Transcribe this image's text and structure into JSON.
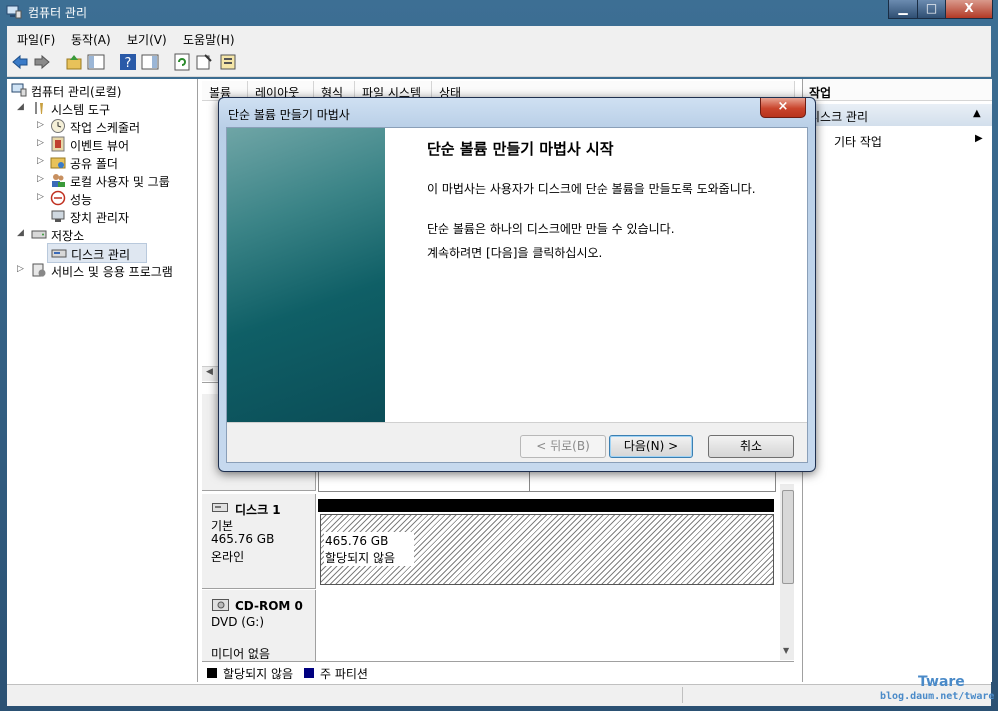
{
  "window": {
    "title": "컴퓨터 관리",
    "min_label": "▁",
    "max_label": "□",
    "close_label": "X"
  },
  "menu": [
    "파일(F)",
    "동작(A)",
    "보기(V)",
    "도움말(H)"
  ],
  "tree": {
    "root": "컴퓨터 관리(로컬)",
    "system_tools": "시스템 도구",
    "task_scheduler": "작업 스케줄러",
    "event_viewer": "이벤트 뷰어",
    "shared_folders": "공유 폴더",
    "local_users": "로컬 사용자 및 그룹",
    "performance": "성능",
    "device_manager": "장치 관리자",
    "storage": "저장소",
    "disk_management": "디스크 관리",
    "services_apps": "서비스 및 응용 프로그램"
  },
  "columns": [
    "볼륨",
    "레이아웃",
    "형식",
    "파일 시스템",
    "상태"
  ],
  "disks": {
    "disk1": {
      "name": "디스크 1",
      "type": "기본",
      "size": "465.76 GB",
      "status": "온라인",
      "part_size": "465.76 GB",
      "part_status": "할당되지 않음"
    },
    "cdrom": {
      "name": "CD-ROM 0",
      "drive": "DVD (G:)",
      "media": "미디어 없음"
    }
  },
  "legend": {
    "unallocated": "할당되지 않음",
    "primary": "주 파티션",
    "unallocated_color": "#000000",
    "primary_color": "#000080"
  },
  "actions": {
    "header": "작업",
    "section": "디스크 관리",
    "more": "기타 작업"
  },
  "wizard": {
    "title": "단순 볼륨 만들기 마법사",
    "heading": "단순 볼륨 만들기 마법사 시작",
    "para1": "이 마법사는 사용자가 디스크에 단순 볼륨을 만들도록 도와줍니다.",
    "para2": "단순 볼륨은 하나의 디스크에만 만들 수 있습니다.",
    "para3": "계속하려면 [다음]을 클릭하십시오.",
    "back_label": "< 뒤로(B)",
    "next_label": "다음(N) >",
    "cancel_label": "취소"
  },
  "watermark": {
    "name": "Tware",
    "url": "blog.daum.net/tware"
  }
}
